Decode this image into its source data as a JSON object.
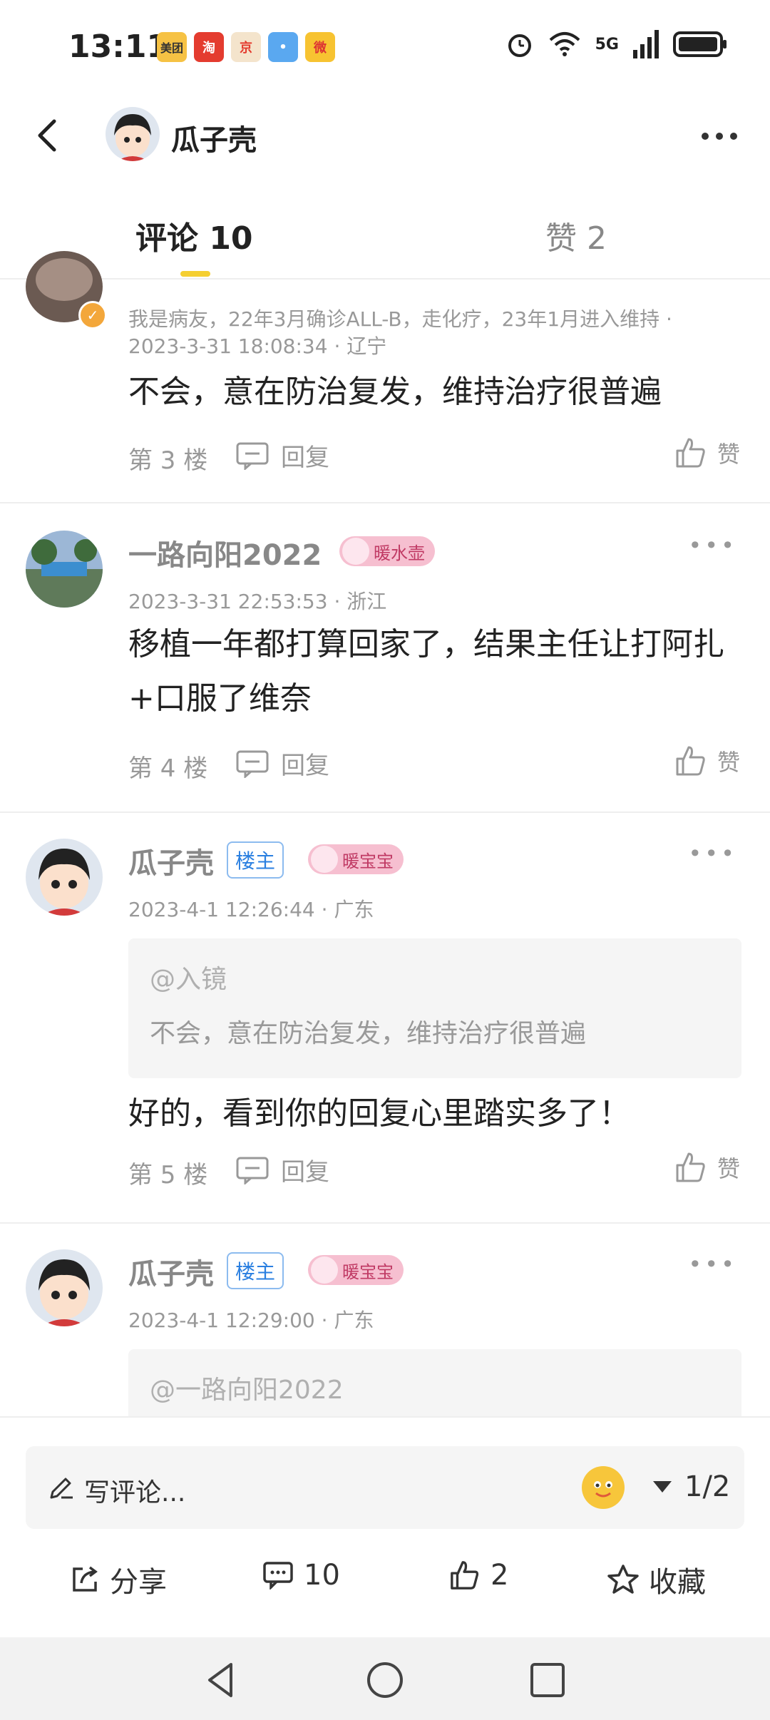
{
  "status_bar": {
    "time": "13:11",
    "apps": [
      {
        "label": "美团",
        "color": "#f6c244"
      },
      {
        "label": "淘",
        "color": "#e43c2f"
      },
      {
        "label": "京",
        "color": "#f4e4cc"
      },
      {
        "label": "•",
        "color": "#5aa8f0"
      },
      {
        "label": "微",
        "color": "#f7c331"
      }
    ],
    "network": "5G"
  },
  "header": {
    "title": "瓜子壳"
  },
  "tabs": {
    "comments_label": "评论 10",
    "likes_label": "赞 2"
  },
  "comments": [
    {
      "bio": "我是病友，22年3月确诊ALL-B，走化疗，23年1月进入维持 ·",
      "meta": "2023-3-31 18:08:34 · 辽宁",
      "content": "不会，意在防治复发，维持治疗很普遍",
      "floor": "第 3 楼",
      "reply": "回复",
      "like": "赞"
    },
    {
      "username": "一路向阳2022",
      "level": "暖水壶",
      "meta": "2023-3-31 22:53:53 · 浙江",
      "content": "移植一年都打算回家了，结果主任让打阿扎+口服了维奈",
      "floor": "第 4 楼",
      "reply": "回复",
      "like": "赞"
    },
    {
      "username": "瓜子壳",
      "owner_badge": "楼主",
      "level": "暖宝宝",
      "meta": "2023-4-1 12:26:44 · 广东",
      "quote_user": "@入镜",
      "quote_text": "不会，意在防治复发，维持治疗很普遍",
      "content": "好的，看到你的回复心里踏实多了！",
      "floor": "第 5 楼",
      "reply": "回复",
      "like": "赞"
    },
    {
      "username": "瓜子壳",
      "owner_badge": "楼主",
      "level": "暖宝宝",
      "meta": "2023-4-1 12:29:00 · 广东",
      "quote_user": "@一路向阳2022"
    }
  ],
  "bottom": {
    "placeholder": "写评论...",
    "page": "1/2",
    "share": "分享",
    "comment_count": "10",
    "like_count": "2",
    "favorite": "收藏"
  },
  "colors": {
    "accent": "#f5cf31",
    "owner_badge": "#2a7fe0",
    "level_badge": "#f6bfd0"
  }
}
